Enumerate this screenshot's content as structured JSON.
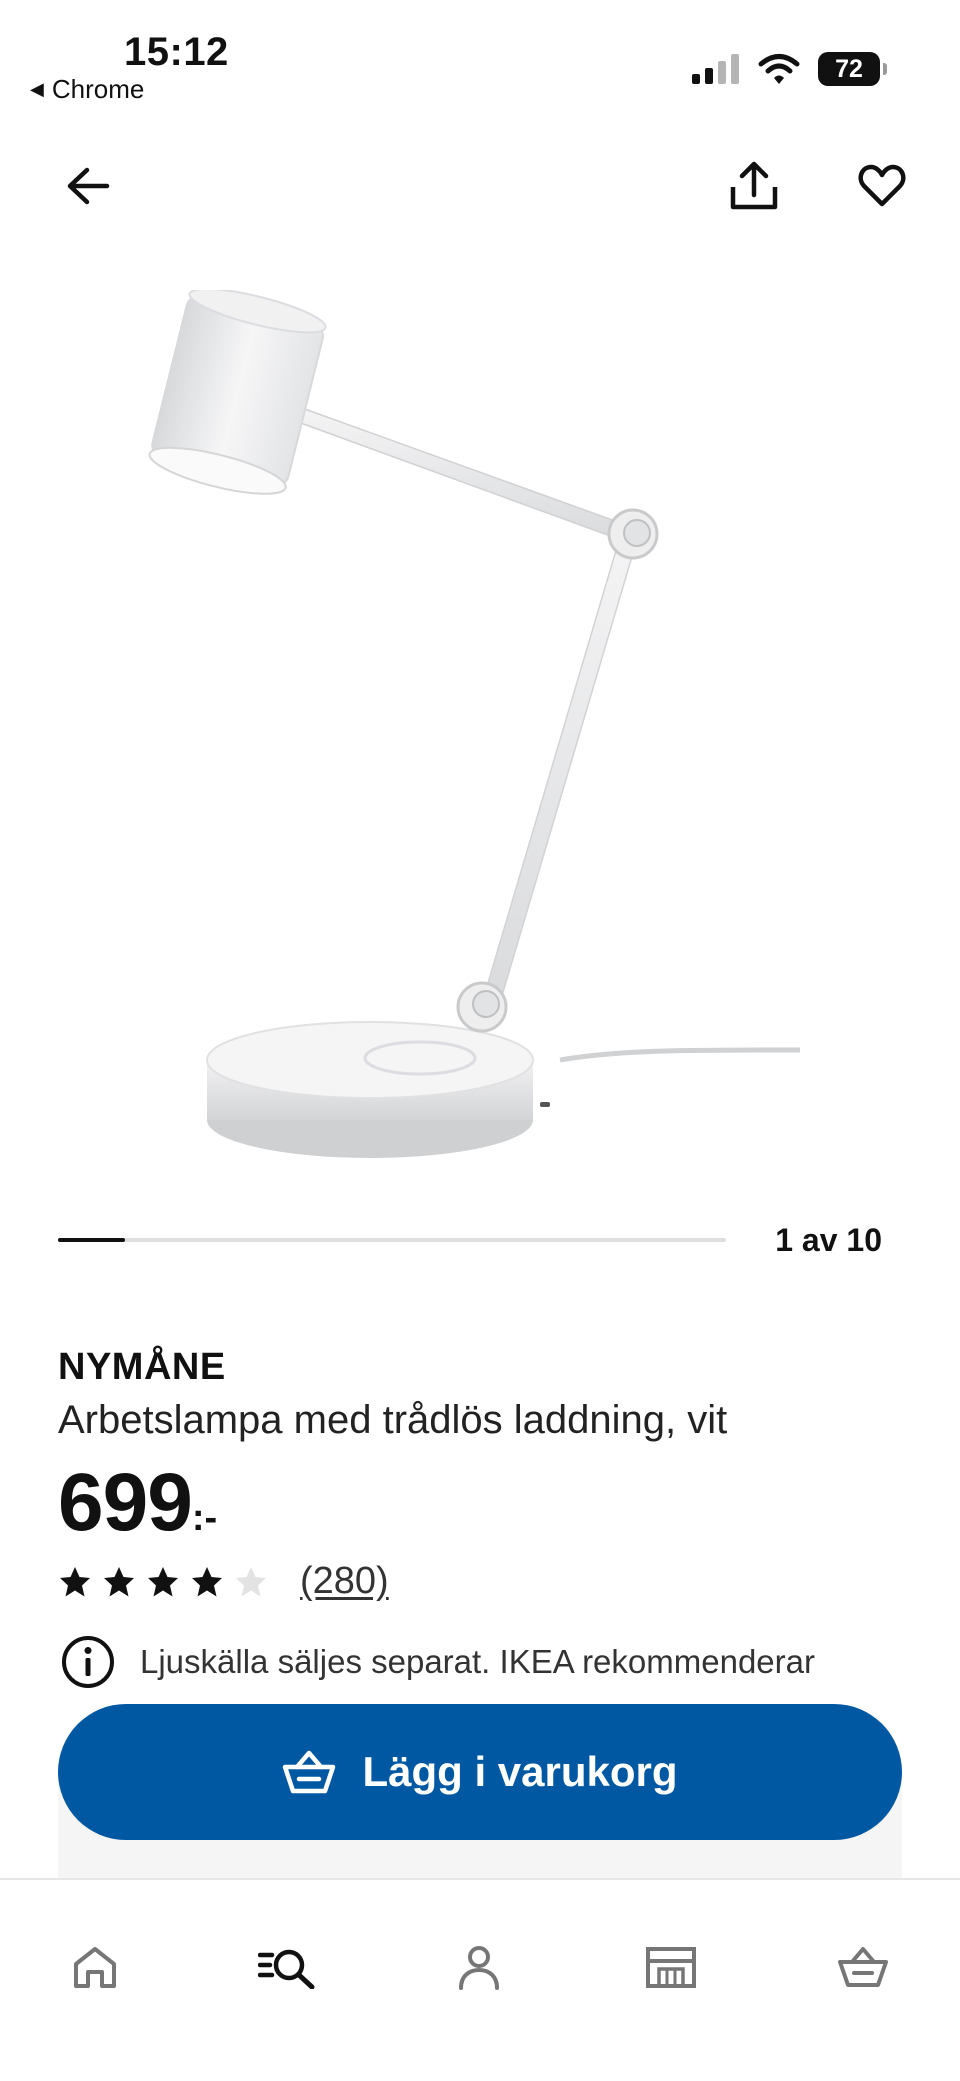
{
  "status_bar": {
    "time": "15:12",
    "back_app": "Chrome",
    "battery": "72"
  },
  "carousel": {
    "counter": "1 av 10",
    "progress": 0.1
  },
  "product": {
    "brand": "NYMÅNE",
    "description": "Arbetslampa med trådlös laddning, vit",
    "price": "699",
    "price_suffix": ":-",
    "rating": 4,
    "rating_max": 5,
    "review_count": "(280)"
  },
  "info": {
    "text": "Ljuskälla säljes separat. IKEA rekommenderar"
  },
  "cart": {
    "label": "Lägg i varukorg"
  },
  "colors": {
    "accent": "#0058a3",
    "text": "#111111"
  },
  "icons": [
    "back-arrow-icon",
    "share-icon",
    "heart-icon",
    "info-icon",
    "basket-icon",
    "home-icon",
    "search-icon",
    "profile-icon",
    "store-icon"
  ]
}
